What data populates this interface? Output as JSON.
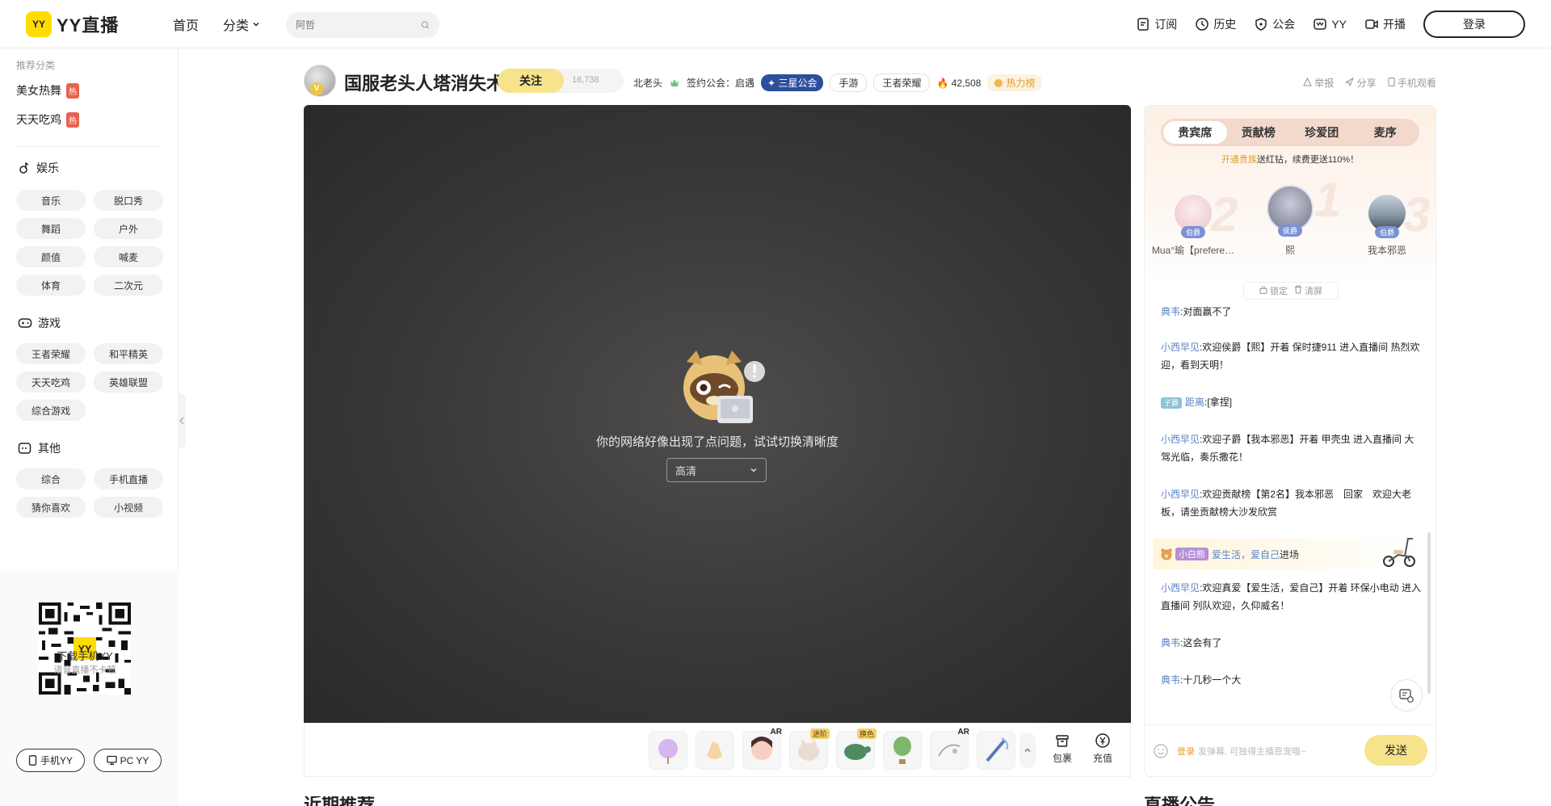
{
  "header": {
    "logo_badge": "YY",
    "logo_text": "YY直播",
    "nav": {
      "home": "首页",
      "category": "分类"
    },
    "search_placeholder": "阿哲",
    "right_nav": {
      "subscribe": "订阅",
      "history": "历史",
      "guild": "公会",
      "yy": "YY",
      "broadcast": "开播",
      "login": "登录"
    }
  },
  "sidebar": {
    "recommend_title": "推荐分类",
    "hot_label": "热",
    "recommended": [
      "美女热舞",
      "天天吃鸡"
    ],
    "sections": [
      {
        "title": "娱乐",
        "items": [
          "音乐",
          "脱口秀",
          "舞蹈",
          "户外",
          "颜值",
          "喊麦",
          "体育",
          "二次元"
        ]
      },
      {
        "title": "游戏",
        "items": [
          "王者荣耀",
          "和平精英",
          "天天吃鸡",
          "英雄联盟",
          "综合游戏"
        ]
      },
      {
        "title": "其他",
        "items": [
          "综合",
          "手机直播",
          "猜你喜欢",
          "小视频"
        ]
      }
    ],
    "qr_title": "下载手机YY",
    "qr_subtitle": "语音直播不卡顿",
    "download_mobile": "手机YY",
    "download_pc": "PC YY"
  },
  "room": {
    "avatar_badge": "V",
    "title": "国服老头人塔消失术",
    "follow_label": "关注",
    "follow_count": "16,738",
    "anchor_name": "北老头",
    "guild_label": "签约公会：启遇",
    "guild_badge": "三星公会",
    "tag_mobile": "手游",
    "tag_game": "王者荣耀",
    "heat": "42,508",
    "heat_rank": "热力榜",
    "tools": {
      "report": "举报",
      "share": "分享",
      "mobile_watch": "手机观看"
    }
  },
  "player": {
    "error_message": "你的网络好像出现了点问题，试试切换清晰度",
    "quality": "高清"
  },
  "gift_bar": {
    "gift_labels": {
      "ar": "AR",
      "advanced": "进阶",
      "transform": "换色"
    },
    "package": "包裹",
    "recharge": "充值"
  },
  "panel": {
    "tabs": [
      "贵宾席",
      "贡献榜",
      "珍爱团",
      "麦序"
    ],
    "promo_highlight": "开通贵族",
    "promo_text": "送红钻，续费更送110%！",
    "podium": [
      {
        "rank": "2",
        "name": "Mua°瑜【prefere…",
        "title": "伯爵"
      },
      {
        "rank": "1",
        "name": "熙",
        "title": "侯爵"
      },
      {
        "rank": "3",
        "name": "我本邪恶",
        "title": "伯爵"
      }
    ],
    "lock": "锁定",
    "clear": "清屏",
    "messages": [
      {
        "user": "典韦",
        "text": ":对面赢不了"
      },
      {
        "user": "小西早见",
        "text": ":欢迎侯爵【熙】开着 保时捷911 进入直播间 热烈欢迎，看到天明！"
      },
      {
        "rank": "子爵",
        "user": "距离",
        "text": ":[拿捏]"
      },
      {
        "user": "小西早见",
        "text": ":欢迎子爵【我本邪恶】开着 甲壳虫 进入直播间 大驾光临，奏乐撒花！"
      },
      {
        "user": "小西早见",
        "text": ":欢迎贡献榜【第2名】我本邪恶　回家　欢迎大老板，请坐贡献榜大沙发欣赏"
      },
      {
        "user": "小西早见",
        "text": ":欢迎真爱【爱生活，爱自己】开着 环保小电动 进入直播间 列队欢迎，久仰威名！"
      },
      {
        "user": "典韦",
        "text": ":这会有了"
      },
      {
        "user": "典韦",
        "text": ":十几秒一个大"
      }
    ],
    "vip_entry": {
      "badge": "小白熊",
      "user": "爱生活，爱自己",
      "action": "进场"
    },
    "input_login": "登录",
    "input_placeholder": "发弹幕, 可独得主播恩宠哦~",
    "send": "发送"
  },
  "below": {
    "left_title": "近期推荐",
    "right_title": "直播公告"
  }
}
